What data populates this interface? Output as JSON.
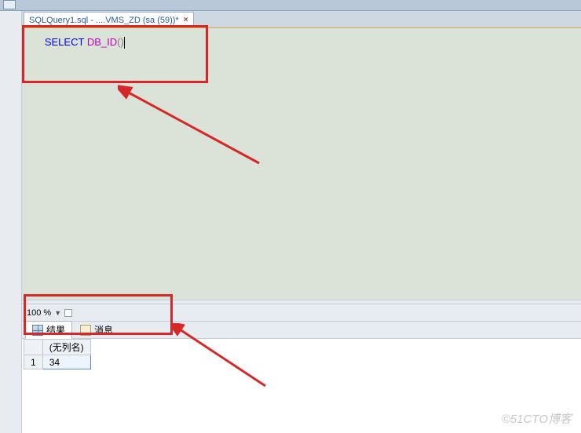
{
  "tab": {
    "title": "SQLQuery1.sql - ....VMS_ZD (sa (59))*",
    "close_glyph": "×"
  },
  "editor": {
    "code": {
      "keyword": "SELECT",
      "func": "DB_ID",
      "parens": "()"
    }
  },
  "zoom": {
    "label": "100 %"
  },
  "result_tabs": {
    "results": "结果",
    "messages": "消息"
  },
  "grid": {
    "header": "(无列名)",
    "rows": [
      {
        "n": "1",
        "v": "34"
      }
    ]
  },
  "watermark": "©51CTO博客"
}
